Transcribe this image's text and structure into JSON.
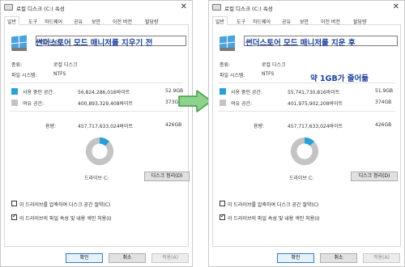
{
  "left": {
    "title": "로컬 디스크 (C:) 속성",
    "tabs": [
      "일반",
      "도구",
      "하드웨어",
      "공유",
      "보안",
      "이전 버전",
      "할당량"
    ],
    "name_value": "로컬 디스크",
    "note": "썬더스토어 모드 매니저를 지우기 전",
    "type_label": "종류:",
    "type_value": "로컬 디스크",
    "fs_label": "파일 시스템:",
    "fs_value": "NTFS",
    "used_label": "사용 중인 공간:",
    "used_bytes": "56,824,286,016바이트",
    "used_size": "52.9GB",
    "free_label": "여유 공간:",
    "free_bytes": "400,893,329,408바이트",
    "free_size": "373GB",
    "cap_label": "용량:",
    "cap_bytes": "457,717,633,024바이트",
    "cap_size": "426GB",
    "drive_label": "드라이브 C:",
    "cleanup_button": "디스크 정리(D)",
    "compress_label": "이 드라이브를 압축하여 디스크 공간 절약(C)",
    "index_label": "이 드라이브의 파일 속성 및 내용 색인 허용(I)",
    "ok": "확인",
    "cancel": "취소",
    "apply": "적용(A)",
    "used_fraction": 0.124
  },
  "right": {
    "title": "로컬 디스크 (C:) 속성",
    "tabs": [
      "일반",
      "도구",
      "하드웨어",
      "공유",
      "보안",
      "이전 버전",
      "할당량"
    ],
    "name_value": "",
    "note": "썬더스토어 모드 매니저를 지운 후",
    "note2": "약 1GB가 줄어듦",
    "type_label": "종류:",
    "type_value": "로컬 디스크",
    "fs_label": "파일 시스템:",
    "fs_value": "NTFS",
    "used_label": "사용 중인 공간:",
    "used_bytes": "55,741,730,816바이트",
    "used_size": "51.9GB",
    "free_label": "여유 공간:",
    "free_bytes": "401,975,902,208바이트",
    "free_size": "374GB",
    "cap_label": "용량:",
    "cap_bytes": "457,717,633,024바이트",
    "cap_size": "426GB",
    "drive_label": "드라이브 C:",
    "cleanup_button": "디스크 정리(D)",
    "compress_label": "이 드라이브를 압축하여 디스크 공간 절약(C)",
    "index_label": "이 드라이브의 파일 속성 및 내용 색인 허용(I)",
    "ok": "확인",
    "cancel": "취소",
    "apply": "적용(A)",
    "used_fraction": 0.122
  },
  "colors": {
    "used": "#26a0da",
    "free": "#c4c4c4",
    "note_text": "#1b3fa0",
    "arrow_fill": "#8fd18f",
    "arrow_stroke": "#3aa03a"
  },
  "icons": {
    "drive": "windows-drive-icon",
    "arrow": "right-arrow-icon"
  }
}
